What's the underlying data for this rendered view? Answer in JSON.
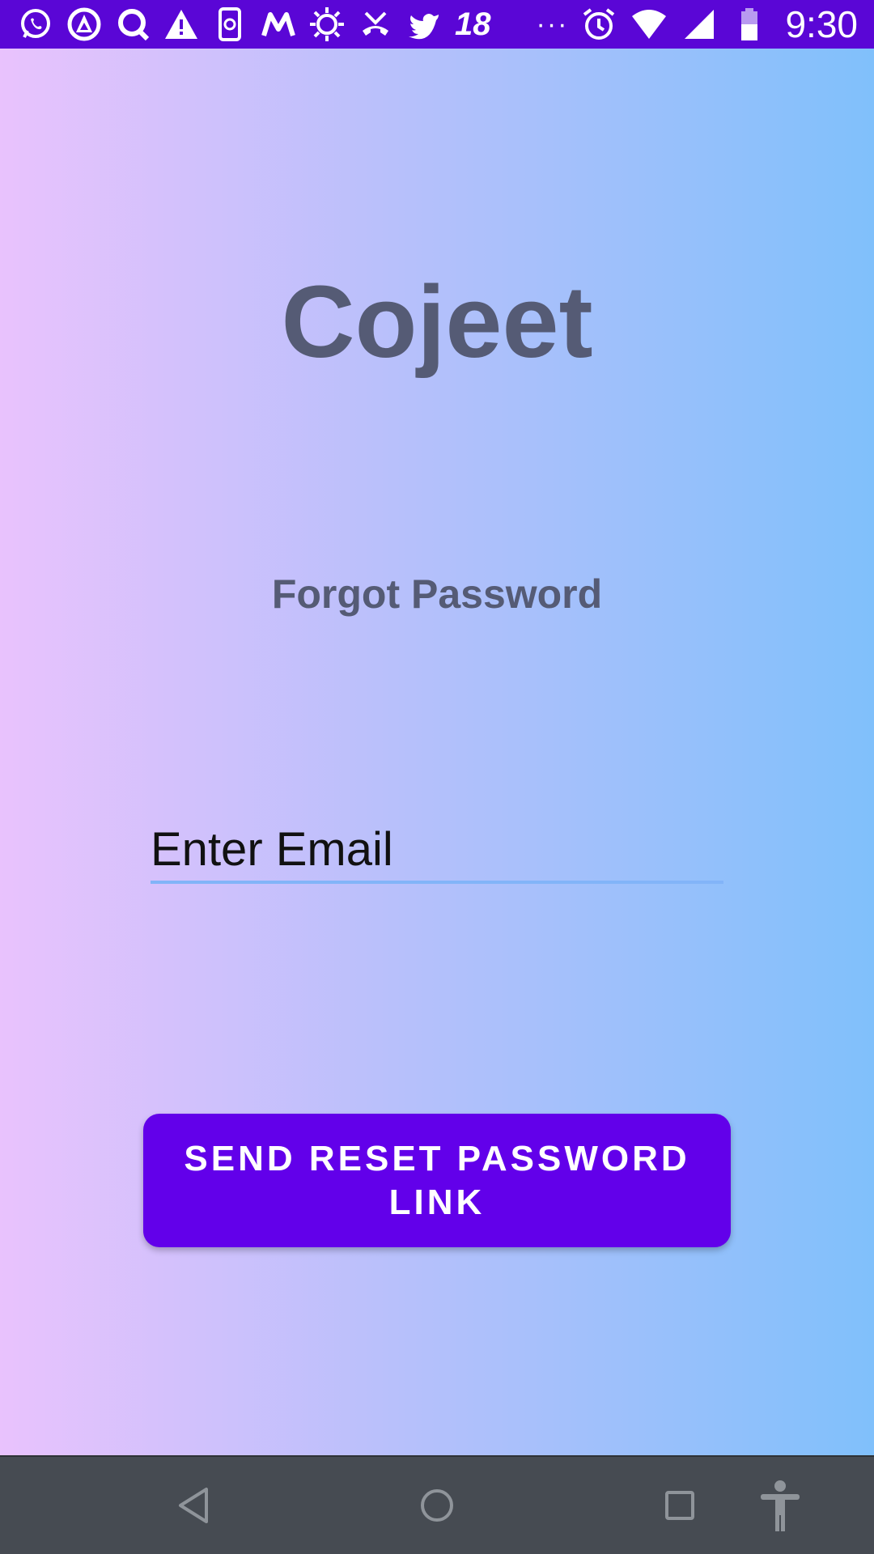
{
  "status_bar": {
    "notification_count": "18",
    "overflow": "···",
    "time": "9:30",
    "background": "#5a06d6",
    "icons_left": [
      "whatsapp-icon",
      "delta-app-icon",
      "search-app-icon",
      "warning-icon",
      "phone-sync-icon",
      "myntra-icon",
      "brightness-icon",
      "missed-call-icon",
      "twitter-icon"
    ],
    "icons_right": [
      "alarm-icon",
      "wifi-icon",
      "signal-icon",
      "battery-icon"
    ]
  },
  "app": {
    "title": "Cojeet",
    "subtitle": "Forgot Password",
    "email_placeholder": "Enter Email",
    "send_button_label": "SEND RESET PASSWORD LINK",
    "accent_color": "#6200ea",
    "text_color": "#555b75",
    "gradient": [
      "#e9c2fd",
      "#80c0fb"
    ]
  },
  "nav_bar": {
    "buttons": [
      "back-icon",
      "home-icon",
      "recents-icon",
      "accessibility-icon"
    ],
    "background": "#464b52"
  }
}
